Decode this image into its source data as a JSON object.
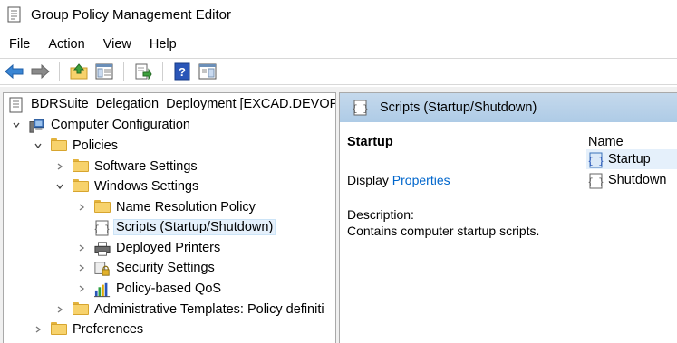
{
  "window": {
    "title": "Group Policy Management Editor"
  },
  "menu": [
    "File",
    "Action",
    "View",
    "Help"
  ],
  "toolbar": {
    "icons": [
      "back-arrow-icon",
      "forward-arrow-icon",
      "up-folder-icon",
      "show-hide-tree-icon",
      "export-list-icon",
      "help-icon",
      "properties-pane-icon"
    ]
  },
  "tree": {
    "root": "BDRSuite_Delegation_Deployment [EXCAD.DEVOPS.",
    "computer_configuration": "Computer Configuration",
    "policies": "Policies",
    "software_settings": "Software Settings",
    "windows_settings": "Windows Settings",
    "name_resolution_policy": "Name Resolution Policy",
    "scripts": "Scripts (Startup/Shutdown)",
    "deployed_printers": "Deployed Printers",
    "security_settings": "Security Settings",
    "policy_based_qos": "Policy-based QoS",
    "admin_templates": "Administrative Templates: Policy definiti",
    "preferences": "Preferences"
  },
  "details": {
    "header": "Scripts (Startup/Shutdown)",
    "title": "Startup",
    "display_prefix": "Display",
    "display_link": "Properties",
    "description_label": "Description:",
    "description_text": "Contains computer startup scripts.",
    "column_name": "Name",
    "items": [
      "Startup",
      "Shutdown"
    ]
  },
  "colors": {
    "selection": "#e5f0fb",
    "header_bar": "#b8d1ea",
    "link": "#0066cc",
    "folder": "#f7d26c"
  }
}
